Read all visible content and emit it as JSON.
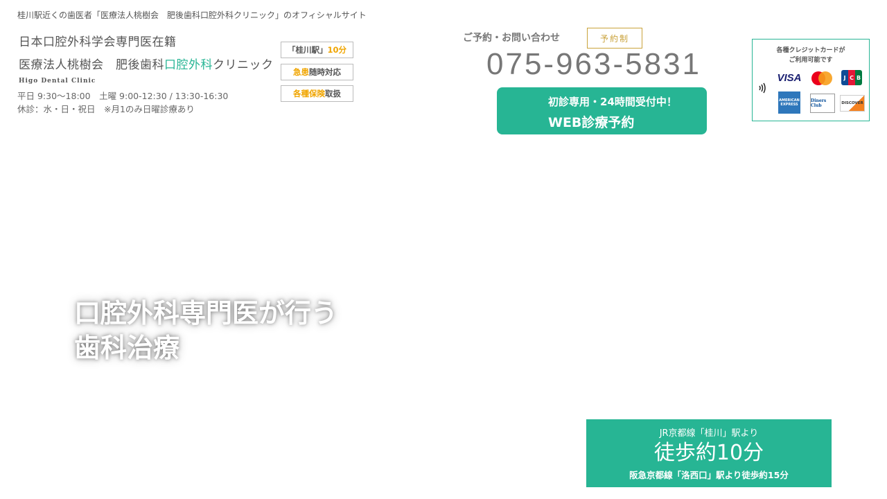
{
  "header": {
    "tagline": "桂川駅近くの歯医者「医療法人桃樹会　肥後歯科口腔外科クリニック」のオフィシャルサイト"
  },
  "logo": {
    "line1": "日本口腔外科学会専門医在籍",
    "line2_prefix": "医療法人桃樹会　肥後歯科",
    "line2_accent": "口腔外科",
    "line2_suffix": "クリニック",
    "line3": "Higo Dental Clinic"
  },
  "hours": {
    "weekday": "平日 9:30〜18:00　土曜 9:00-12:30 / 13:30-16:30",
    "closed": "休診：水・日・祝日　※月1のみ日曜診療あり"
  },
  "badges": [
    {
      "pre": "「桂川駅」",
      "hl": "10分",
      "post": ""
    },
    {
      "pre": "",
      "hl": "急患",
      "post": "随時対応"
    },
    {
      "pre": "",
      "hl": "各種保険",
      "post": "取扱"
    }
  ],
  "contact": {
    "label": "ご予約・お問い合わせ",
    "reserve_tag": "予約制",
    "phone": "075-963-5831"
  },
  "web_reservation": {
    "line1": "初診専用・24時間受付中！",
    "line2": "WEB診療予約"
  },
  "credit_cards": {
    "title_line1": "各種クレジットカードが",
    "title_line2": "ご利用可能です",
    "brands": [
      "VISA",
      "JCB",
      "AMERICAN EXPRESS",
      "Diners Club",
      "DISCOVER"
    ]
  },
  "hero": {
    "line1": "口腔外科専門医が行う",
    "line2": "歯科治療"
  },
  "access": {
    "line1": "JR京都線「桂川」駅より",
    "line2": "徒歩約10分",
    "line3": "阪急京都線「洛西口」駅より徒歩約15分"
  },
  "colors": {
    "accent": "#27b594",
    "highlight": "#f0a500",
    "gold": "#c9a23a"
  }
}
